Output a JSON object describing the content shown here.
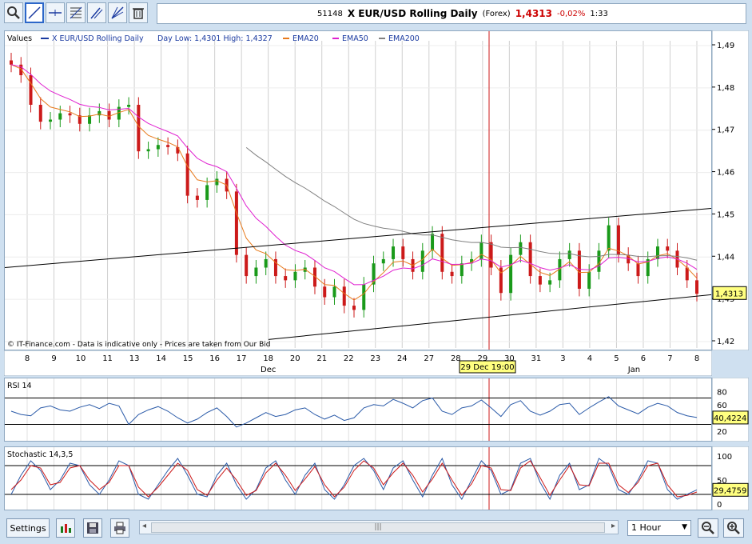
{
  "header": {
    "ticker": "51148",
    "name": "X EUR/USD Rolling Daily",
    "type": "(Forex)",
    "price": "1,4313",
    "change": "-0,02%",
    "time": "1:33"
  },
  "legend": {
    "values": "Values",
    "series": "X EUR/USD Rolling Daily",
    "daylow": "Day Low: 1,4301 High: 1,4327",
    "ema20": "EMA20",
    "ema50": "EMA50",
    "ema200": "EMA200"
  },
  "colors": {
    "ema20": "#e87a1c",
    "ema50": "#e020d0",
    "ema200": "#808080",
    "up": "#1a9a1a",
    "down": "#cc1a1a"
  },
  "footer_note": "© IT-Finance.com - Data is indicative only - Prices are taken from Our Bid",
  "cursor_label": "29 Dec 19:00",
  "chart_data": [
    {
      "type": "candlestick",
      "ylim": [
        1.42,
        1.49
      ],
      "ticks": [
        "1,49",
        "1,48",
        "1,47",
        "1,46",
        "1,45",
        "1,44",
        "1,43",
        "1,42"
      ],
      "x_labels": [
        "8",
        "9",
        "10",
        "11",
        "13",
        "14",
        "15",
        "16",
        "17",
        "18",
        "20",
        "21",
        "22",
        "23",
        "24",
        "27",
        "28",
        "29",
        "30",
        "31",
        "3",
        "4",
        "5",
        "6",
        "7",
        "8"
      ],
      "months": [
        "Dec",
        "Jan"
      ],
      "last": "1,4313",
      "close": [
        1.4855,
        1.483,
        1.476,
        1.472,
        1.4725,
        1.474,
        1.4735,
        1.4715,
        1.4735,
        1.4745,
        1.4725,
        1.4755,
        1.476,
        1.465,
        1.4655,
        1.4665,
        1.466,
        1.4645,
        1.4545,
        1.4535,
        1.457,
        1.4585,
        1.4555,
        1.4405,
        1.4355,
        1.4375,
        1.4395,
        1.4355,
        1.4345,
        1.4365,
        1.4375,
        1.433,
        1.4305,
        1.433,
        1.4285,
        1.4275,
        1.4335,
        1.4385,
        1.4395,
        1.4425,
        1.4395,
        1.4365,
        1.4415,
        1.4455,
        1.4365,
        1.4355,
        1.4385,
        1.4395,
        1.4435,
        1.4375,
        1.4315,
        1.4405,
        1.4435,
        1.4355,
        1.4335,
        1.4345,
        1.4395,
        1.4415,
        1.4325,
        1.4365,
        1.4415,
        1.4475,
        1.4405,
        1.4385,
        1.4355,
        1.4395,
        1.4425,
        1.4415,
        1.4375,
        1.4345,
        1.4313
      ]
    },
    {
      "type": "line",
      "name": "RSI 14",
      "ticks": [
        "80",
        "60",
        "40",
        "20"
      ],
      "last": "40,4224",
      "values": [
        50,
        45,
        43,
        55,
        58,
        52,
        50,
        56,
        60,
        54,
        62,
        58,
        30,
        45,
        52,
        57,
        50,
        40,
        32,
        38,
        48,
        55,
        42,
        26,
        32,
        40,
        48,
        42,
        45,
        52,
        55,
        45,
        38,
        44,
        36,
        40,
        55,
        60,
        58,
        68,
        62,
        55,
        66,
        70,
        50,
        45,
        55,
        58,
        67,
        55,
        42,
        60,
        66,
        50,
        44,
        50,
        60,
        62,
        45,
        55,
        64,
        72,
        58,
        52,
        46,
        56,
        62,
        58,
        48,
        43,
        40.4
      ]
    },
    {
      "type": "line",
      "name": "Stochastic 14,3,5",
      "ticks": [
        "100",
        "50",
        "0"
      ],
      "last": "29,4759",
      "k": [
        20,
        60,
        90,
        70,
        30,
        50,
        85,
        80,
        40,
        20,
        50,
        90,
        80,
        20,
        10,
        40,
        70,
        95,
        60,
        20,
        15,
        60,
        85,
        40,
        10,
        30,
        75,
        90,
        50,
        20,
        60,
        85,
        30,
        10,
        40,
        80,
        95,
        70,
        30,
        75,
        90,
        50,
        15,
        60,
        95,
        40,
        10,
        50,
        90,
        70,
        20,
        30,
        85,
        95,
        45,
        10,
        60,
        85,
        30,
        40,
        95,
        80,
        30,
        20,
        50,
        90,
        85,
        30,
        10,
        20,
        29.5
      ],
      "d": [
        30,
        50,
        80,
        75,
        40,
        45,
        75,
        80,
        50,
        30,
        45,
        80,
        80,
        35,
        15,
        35,
        60,
        85,
        70,
        30,
        18,
        50,
        75,
        50,
        18,
        28,
        65,
        85,
        60,
        28,
        52,
        78,
        40,
        15,
        35,
        70,
        90,
        75,
        40,
        65,
        85,
        60,
        25,
        52,
        85,
        50,
        18,
        42,
        80,
        75,
        30,
        28,
        75,
        90,
        55,
        18,
        50,
        80,
        40,
        38,
        85,
        85,
        40,
        24,
        45,
        80,
        85,
        40,
        15,
        18,
        25
      ]
    }
  ],
  "controls": {
    "settings": "Settings",
    "interval": "1 Hour"
  }
}
